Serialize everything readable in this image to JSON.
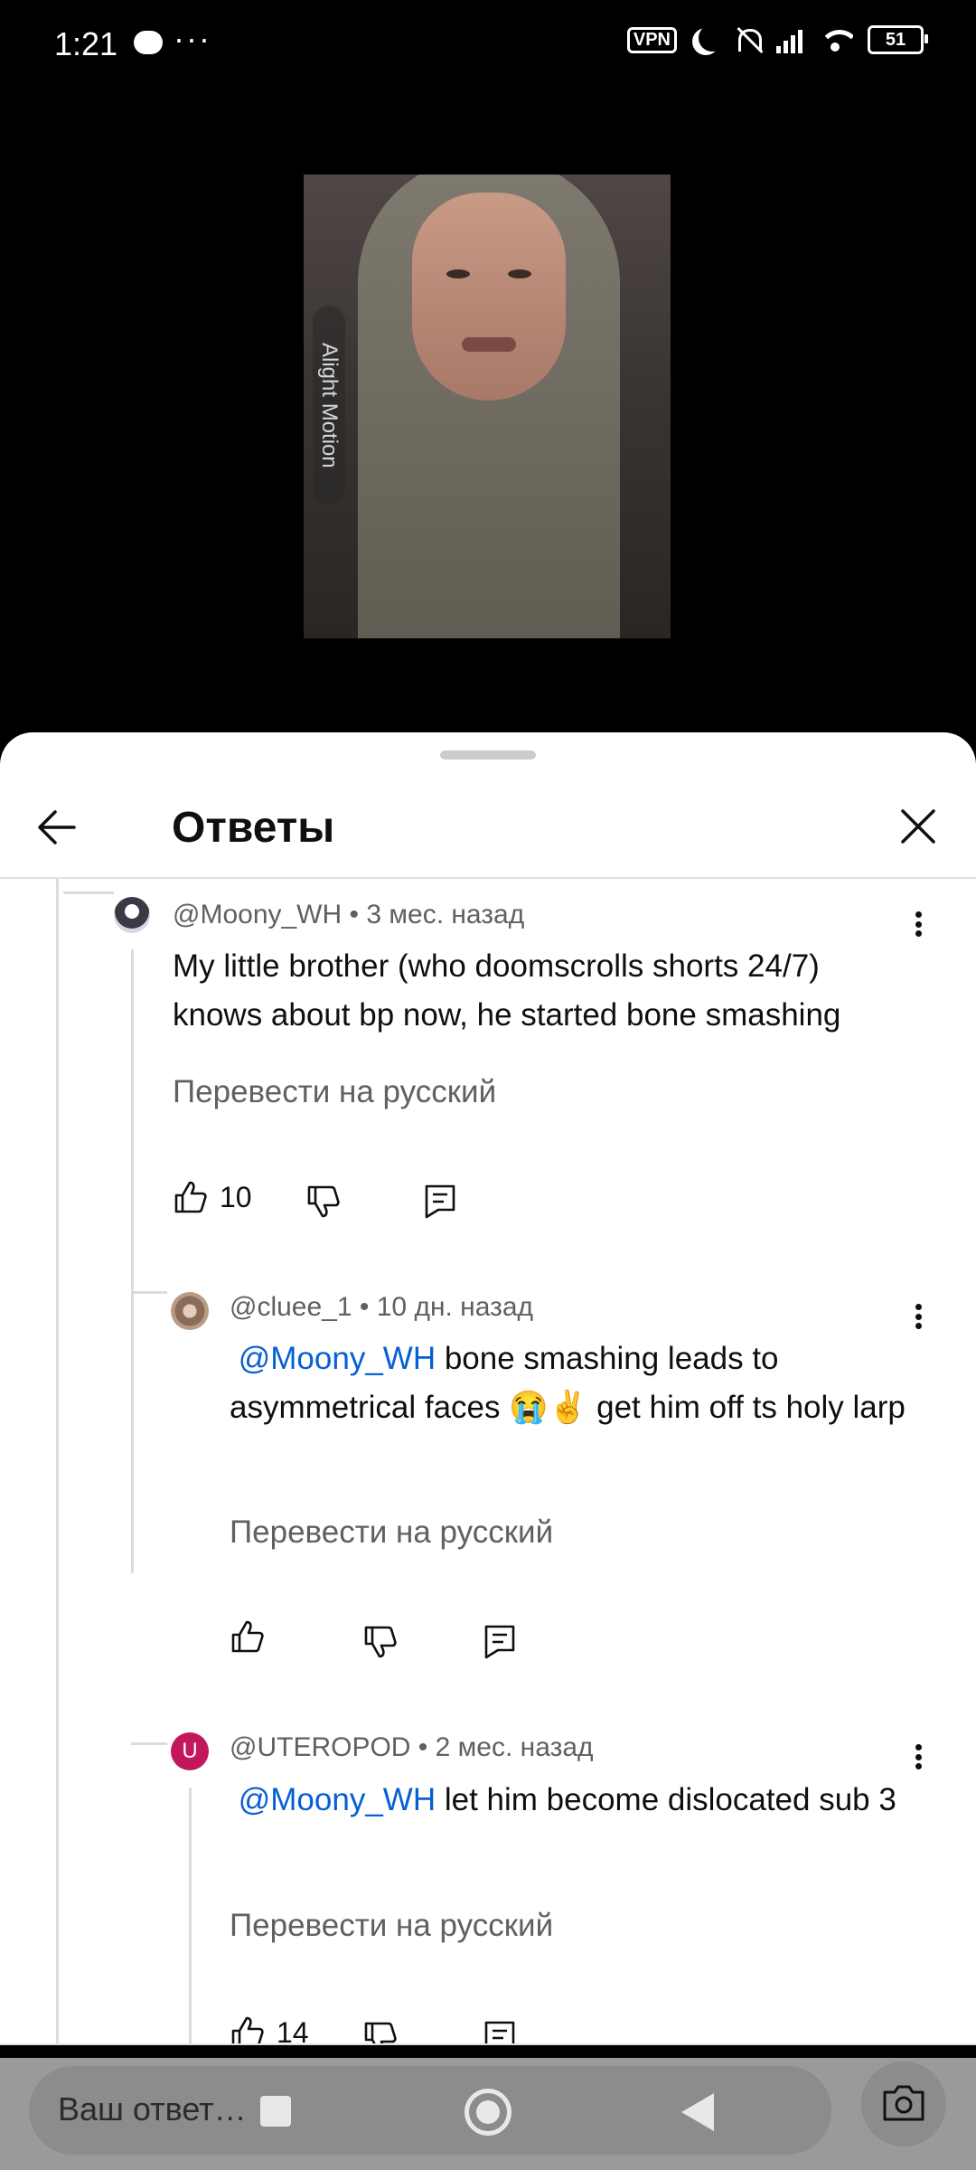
{
  "status_bar": {
    "time": "1:21",
    "more": "···",
    "vpn": "VPN",
    "battery": "51"
  },
  "video": {
    "watermark": "Alight Motion"
  },
  "sheet": {
    "title": "Ответы"
  },
  "comments": [
    {
      "author": "@Moony_WH",
      "age": "3 мес. назад",
      "text": "My little brother (who doomscrolls shorts 24/7) knows about bp now, he started bone smashing",
      "translate": "Перевести на русский",
      "likes": "10"
    },
    {
      "author": "@cluee_1",
      "age": "10 дн. назад",
      "mention": "@Moony_WH",
      "text": " bone smashing leads to asymmetrical faces 😭✌️ get him off ts holy larp",
      "translate": "Перевести на русский",
      "likes": ""
    },
    {
      "author": "@UTEROPOD",
      "avatar_letter": "U",
      "avatar_color": "#c2185b",
      "age": "2 мес. назад",
      "mention": "@Moony_WH",
      "text": "let him become dislocated sub 3",
      "translate": "Перевести на русский",
      "likes": "14"
    }
  ],
  "reply_bar": {
    "placeholder": "Ваш ответ…"
  },
  "colors": {
    "mention": "#065fd4",
    "meta": "#606060",
    "text": "#0f0f0f"
  }
}
